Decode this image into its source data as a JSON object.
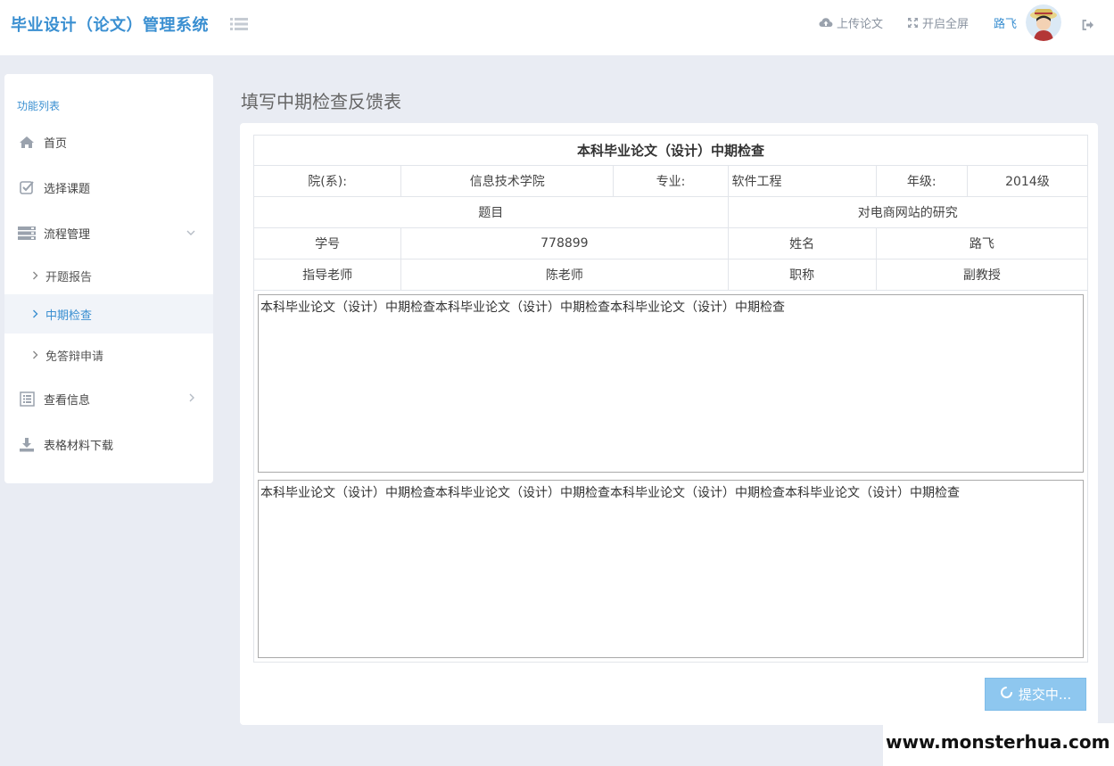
{
  "header": {
    "app_title": "毕业设计（论文）管理系统",
    "upload_label": "上传论文",
    "fullscreen_label": "开启全屏",
    "username": "路飞",
    "accent_color": "#3a8fd1"
  },
  "sidebar": {
    "title": "功能列表",
    "items": {
      "home": "首页",
      "select_topic": "选择课题",
      "process": "流程管理",
      "opening_report": "开题报告",
      "midterm_check": "中期检查",
      "defense_exemption": "免答辩申请",
      "view_info": "查看信息",
      "downloads": "表格材料下载"
    }
  },
  "page": {
    "title": "填写中期检查反馈表"
  },
  "form": {
    "caption": "本科毕业论文（设计）中期检查",
    "dept_label": "院(系):",
    "dept_value": "信息技术学院",
    "major_label": "专业:",
    "major_value": "软件工程",
    "grade_label": "年级:",
    "grade_value": "2014级",
    "topic_label": "题目",
    "topic_value": "对电商网站的研究",
    "student_id_label": "学号",
    "student_id_value": "778899",
    "name_label": "姓名",
    "name_value": "路飞",
    "advisor_label": "指导老师",
    "advisor_value": "陈老师",
    "title_label": "职称",
    "title_value": "副教授",
    "text1": "本科毕业论文（设计）中期检查本科毕业论文（设计）中期检查本科毕业论文（设计）中期检查",
    "text2": "本科毕业论文（设计）中期检查本科毕业论文（设计）中期检查本科毕业论文（设计）中期检查本科毕业论文（设计）中期检查",
    "submit_label": "提交中..."
  },
  "watermark": "www.monsterhua.com"
}
